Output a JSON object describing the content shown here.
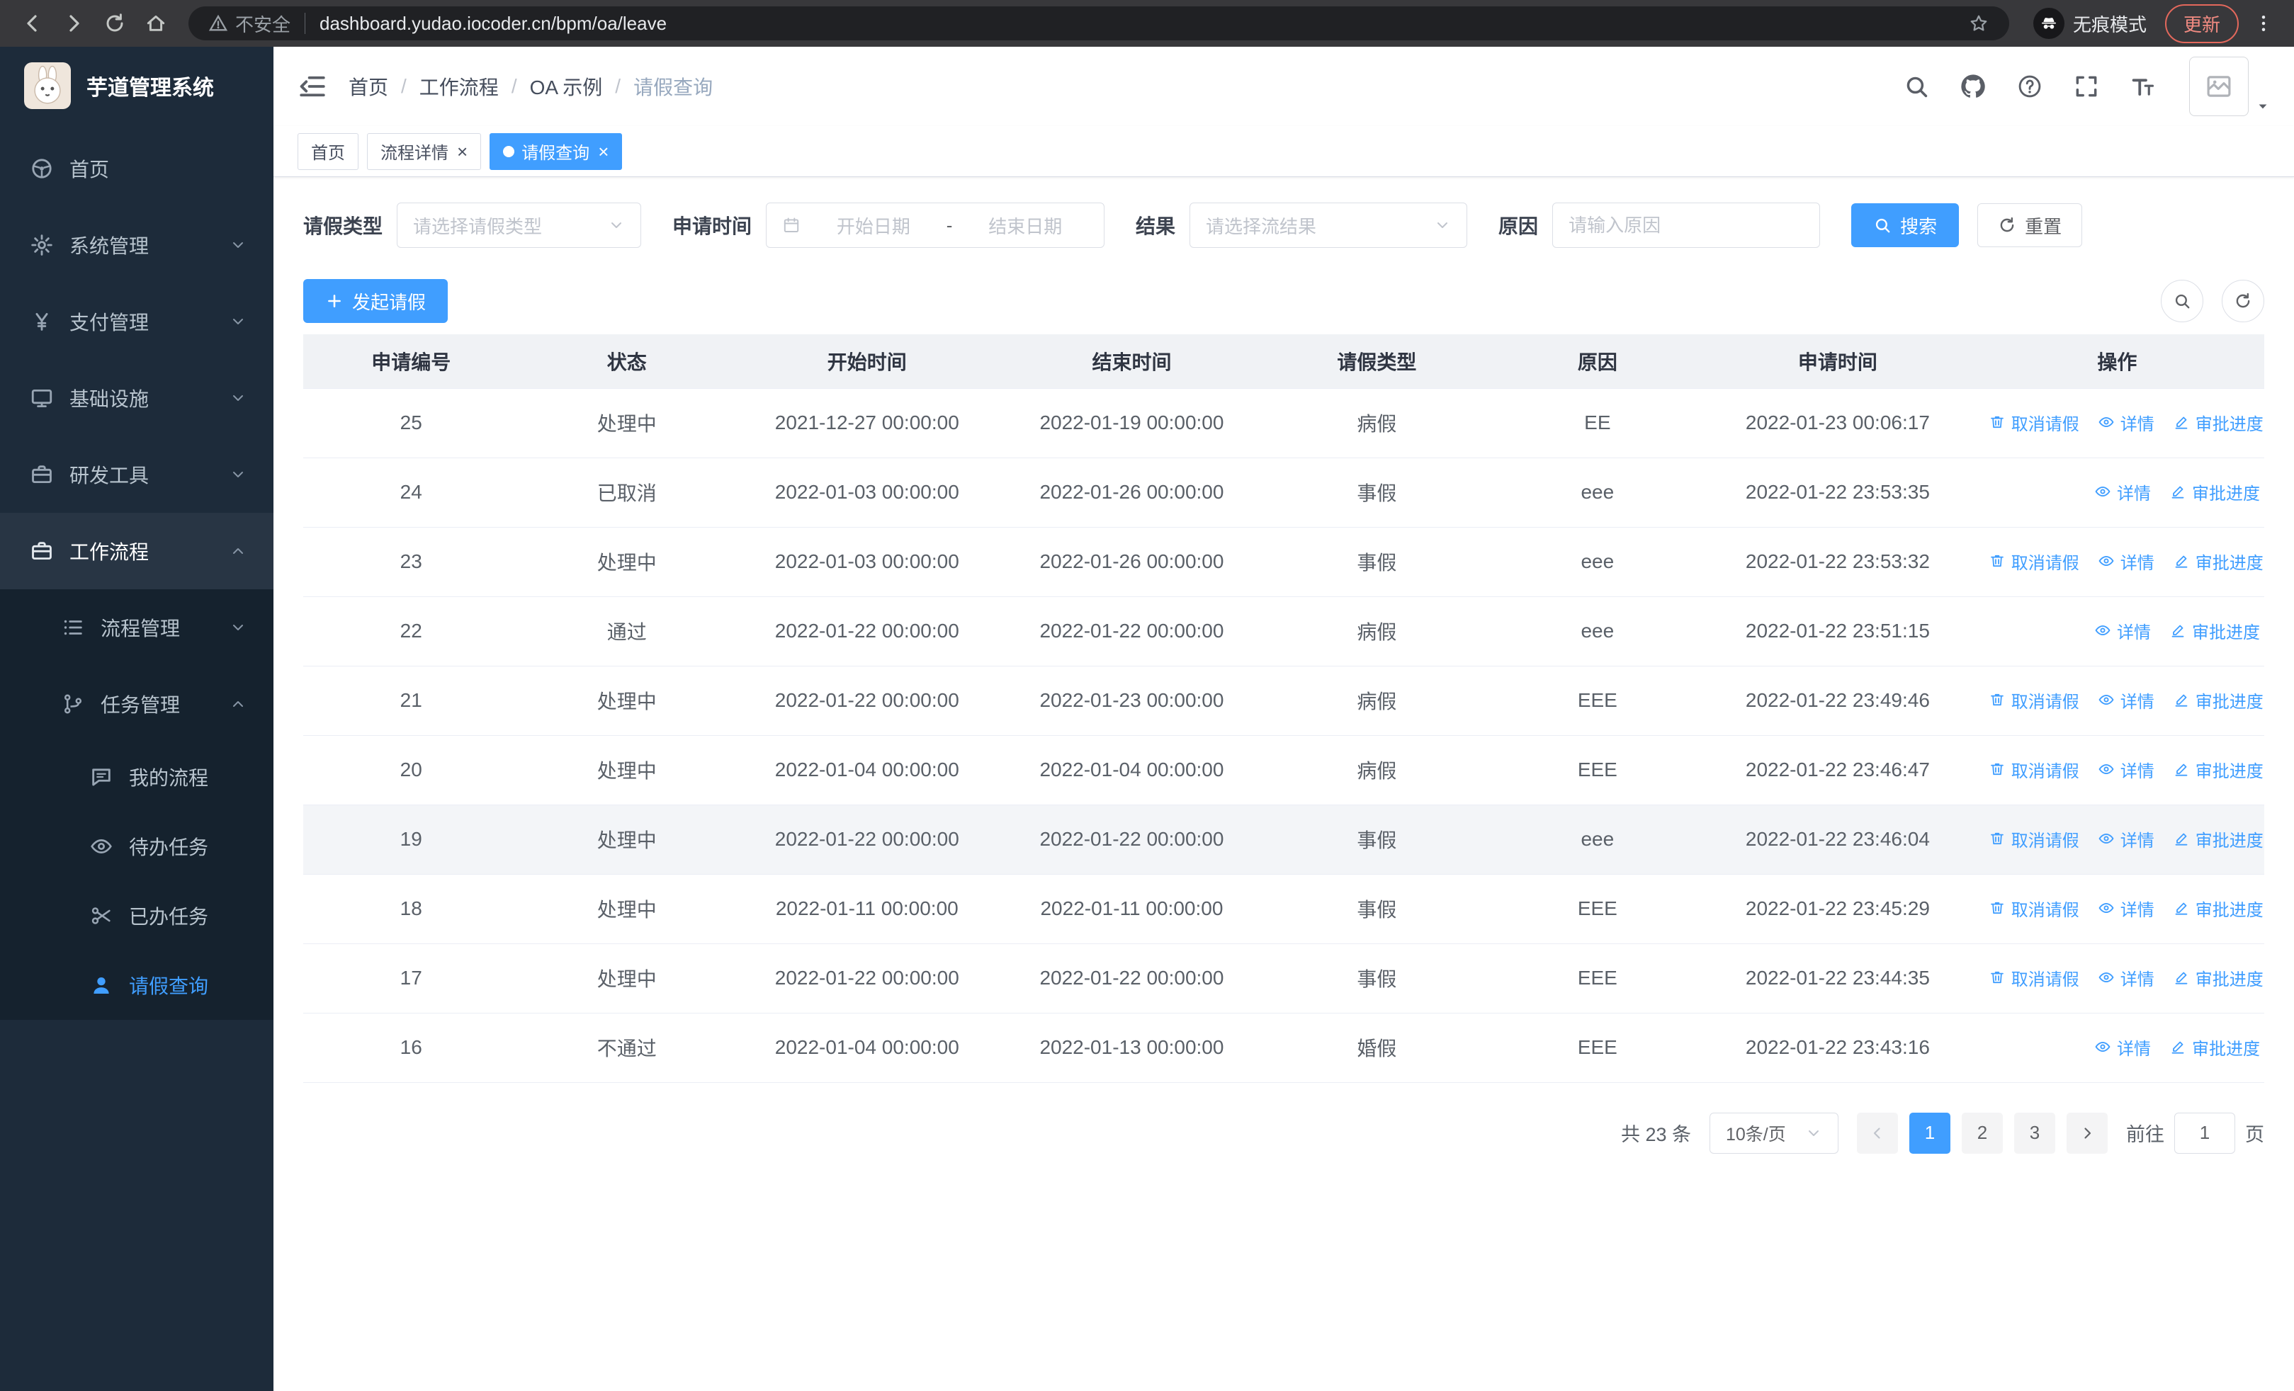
{
  "colors": {
    "primary": "#409eff",
    "sidebar_bg": "#1d2b3a",
    "submenu_bg": "#15222e"
  },
  "browser": {
    "nav_icons": [
      "arrow-left",
      "arrow-right",
      "refresh",
      "home"
    ],
    "security_label": "不安全",
    "url": "dashboard.yudao.iocoder.cn/bpm/oa/leave",
    "incognito_label": "无痕模式",
    "update_label": "更新"
  },
  "sidebar": {
    "logo_title": "芋道管理系统",
    "items": [
      {
        "name": "home",
        "label": "首页",
        "icon": "dashboard",
        "level": 1
      },
      {
        "name": "system",
        "label": "系统管理",
        "icon": "gear",
        "level": 1,
        "chevron": "down"
      },
      {
        "name": "payment",
        "label": "支付管理",
        "icon": "yen",
        "level": 1,
        "chevron": "down"
      },
      {
        "name": "infrastructure",
        "label": "基础设施",
        "icon": "monitor",
        "level": 1,
        "chevron": "down"
      },
      {
        "name": "dev-tools",
        "label": "研发工具",
        "icon": "briefcase",
        "level": 1,
        "chevron": "down"
      },
      {
        "name": "workflow",
        "label": "工作流程",
        "icon": "briefcase",
        "level": 1,
        "chevron": "up",
        "expanded": true
      },
      {
        "name": "process-mgmt",
        "label": "流程管理",
        "icon": "list",
        "level": 2,
        "chevron": "down"
      },
      {
        "name": "task-mgmt",
        "label": "任务管理",
        "icon": "branch",
        "level": 2,
        "chevron": "up",
        "expanded": true
      },
      {
        "name": "my-process",
        "label": "我的流程",
        "icon": "comment",
        "level": 3
      },
      {
        "name": "todo-tasks",
        "label": "待办任务",
        "icon": "eye",
        "level": 3
      },
      {
        "name": "done-tasks",
        "label": "已办任务",
        "icon": "scissors",
        "level": 3
      },
      {
        "name": "leave-query",
        "label": "请假查询",
        "icon": "user",
        "level": 3,
        "active": true
      }
    ]
  },
  "header": {
    "breadcrumbs": [
      "首页",
      "工作流程",
      "OA 示例",
      "请假查询"
    ],
    "action_icons": [
      "search",
      "github",
      "question",
      "fullscreen",
      "font-size"
    ]
  },
  "tabs": [
    {
      "name": "home",
      "label": "首页",
      "closable": false,
      "active": false
    },
    {
      "name": "process-detail",
      "label": "流程详情",
      "closable": true,
      "active": false
    },
    {
      "name": "leave-query",
      "label": "请假查询",
      "closable": true,
      "active": true
    }
  ],
  "filters": {
    "leave_type_label": "请假类型",
    "leave_type_placeholder": "请选择请假类型",
    "apply_time_label": "申请时间",
    "start_date_placeholder": "开始日期",
    "range_separator": "-",
    "end_date_placeholder": "结束日期",
    "result_label": "结果",
    "result_placeholder": "请选择流结果",
    "reason_label": "原因",
    "reason_placeholder": "请输入原因",
    "search_label": "搜索",
    "reset_label": "重置"
  },
  "toolbar": {
    "create_label": "发起请假",
    "tool_icons": [
      "search",
      "refresh"
    ]
  },
  "table": {
    "columns": [
      "申请编号",
      "状态",
      "开始时间",
      "结束时间",
      "请假类型",
      "原因",
      "申请时间",
      "操作"
    ],
    "col_widths": [
      "11%",
      "11%",
      "13.5%",
      "13.5%",
      "11.5%",
      "11%",
      "13.5%",
      "15%"
    ],
    "action_labels": {
      "cancel": "取消请假",
      "detail": "详情",
      "progress": "审批进度"
    },
    "rows": [
      {
        "id": "25",
        "status": "处理中",
        "start": "2021-12-27 00:00:00",
        "end": "2022-01-19 00:00:00",
        "type": "病假",
        "reason": "EE",
        "apply_time": "2022-01-23 00:06:17",
        "actions": [
          "cancel",
          "detail",
          "progress"
        ]
      },
      {
        "id": "24",
        "status": "已取消",
        "start": "2022-01-03 00:00:00",
        "end": "2022-01-26 00:00:00",
        "type": "事假",
        "reason": "eee",
        "apply_time": "2022-01-22 23:53:35",
        "actions": [
          "detail",
          "progress"
        ]
      },
      {
        "id": "23",
        "status": "处理中",
        "start": "2022-01-03 00:00:00",
        "end": "2022-01-26 00:00:00",
        "type": "事假",
        "reason": "eee",
        "apply_time": "2022-01-22 23:53:32",
        "actions": [
          "cancel",
          "detail",
          "progress"
        ]
      },
      {
        "id": "22",
        "status": "通过",
        "start": "2022-01-22 00:00:00",
        "end": "2022-01-22 00:00:00",
        "type": "病假",
        "reason": "eee",
        "apply_time": "2022-01-22 23:51:15",
        "actions": [
          "detail",
          "progress"
        ]
      },
      {
        "id": "21",
        "status": "处理中",
        "start": "2022-01-22 00:00:00",
        "end": "2022-01-23 00:00:00",
        "type": "病假",
        "reason": "EEE",
        "apply_time": "2022-01-22 23:49:46",
        "actions": [
          "cancel",
          "detail",
          "progress"
        ]
      },
      {
        "id": "20",
        "status": "处理中",
        "start": "2022-01-04 00:00:00",
        "end": "2022-01-04 00:00:00",
        "type": "病假",
        "reason": "EEE",
        "apply_time": "2022-01-22 23:46:47",
        "actions": [
          "cancel",
          "detail",
          "progress"
        ]
      },
      {
        "id": "19",
        "status": "处理中",
        "start": "2022-01-22 00:00:00",
        "end": "2022-01-22 00:00:00",
        "type": "事假",
        "reason": "eee",
        "apply_time": "2022-01-22 23:46:04",
        "actions": [
          "cancel",
          "detail",
          "progress"
        ],
        "highlighted": true
      },
      {
        "id": "18",
        "status": "处理中",
        "start": "2022-01-11 00:00:00",
        "end": "2022-01-11 00:00:00",
        "type": "事假",
        "reason": "EEE",
        "apply_time": "2022-01-22 23:45:29",
        "actions": [
          "cancel",
          "detail",
          "progress"
        ]
      },
      {
        "id": "17",
        "status": "处理中",
        "start": "2022-01-22 00:00:00",
        "end": "2022-01-22 00:00:00",
        "type": "事假",
        "reason": "EEE",
        "apply_time": "2022-01-22 23:44:35",
        "actions": [
          "cancel",
          "detail",
          "progress"
        ]
      },
      {
        "id": "16",
        "status": "不通过",
        "start": "2022-01-04 00:00:00",
        "end": "2022-01-13 00:00:00",
        "type": "婚假",
        "reason": "EEE",
        "apply_time": "2022-01-22 23:43:16",
        "actions": [
          "detail",
          "progress"
        ]
      }
    ]
  },
  "pagination": {
    "total_label": "共 23 条",
    "page_size_label": "10条/页",
    "pages": [
      "1",
      "2",
      "3"
    ],
    "current_page": "1",
    "goto_label": "前往",
    "goto_value": "1",
    "page_unit_label": "页"
  }
}
